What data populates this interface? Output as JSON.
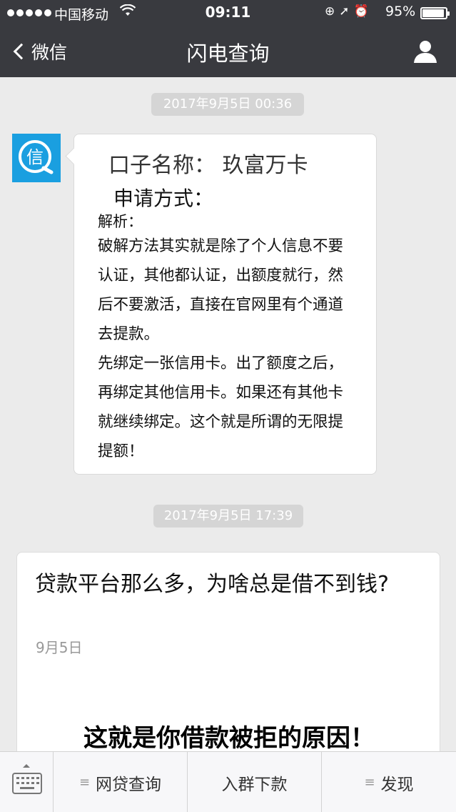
{
  "status_bar": {
    "carrier": "中国移动",
    "time": "09:11",
    "battery_percent": "95%",
    "battery_level": 0.95
  },
  "nav": {
    "back_label": "微信",
    "title": "闪电查询"
  },
  "messages": [
    {
      "timestamp": "2017年9月5日 00:36",
      "avatar_text": "信",
      "title": "口子名称：  玖富万卡",
      "method": "申请方式：",
      "analysis_label": "解析：",
      "lines": [
        "破解方法其实就是除了个人信息不要",
        "认证，其他都认证，出额度就行，然",
        "后不要激活，直接在官网里有个通道",
        "去提款。",
        " 先绑定一张信用卡。出了额度之后，",
        "再绑定其他信用卡。如果还有其他卡",
        "就继续绑定。这个就是所谓的无限提",
        "提额！"
      ]
    },
    {
      "timestamp": "2017年9月5日 17:39",
      "article_title": "贷款平台那么多，为啥总是借不到钱?",
      "article_date": "9月5日",
      "article_headline": "这就是你借款被拒的原因！"
    }
  ],
  "bottom_menu": {
    "items": [
      "网贷查询",
      "入群下款",
      "发现"
    ]
  }
}
